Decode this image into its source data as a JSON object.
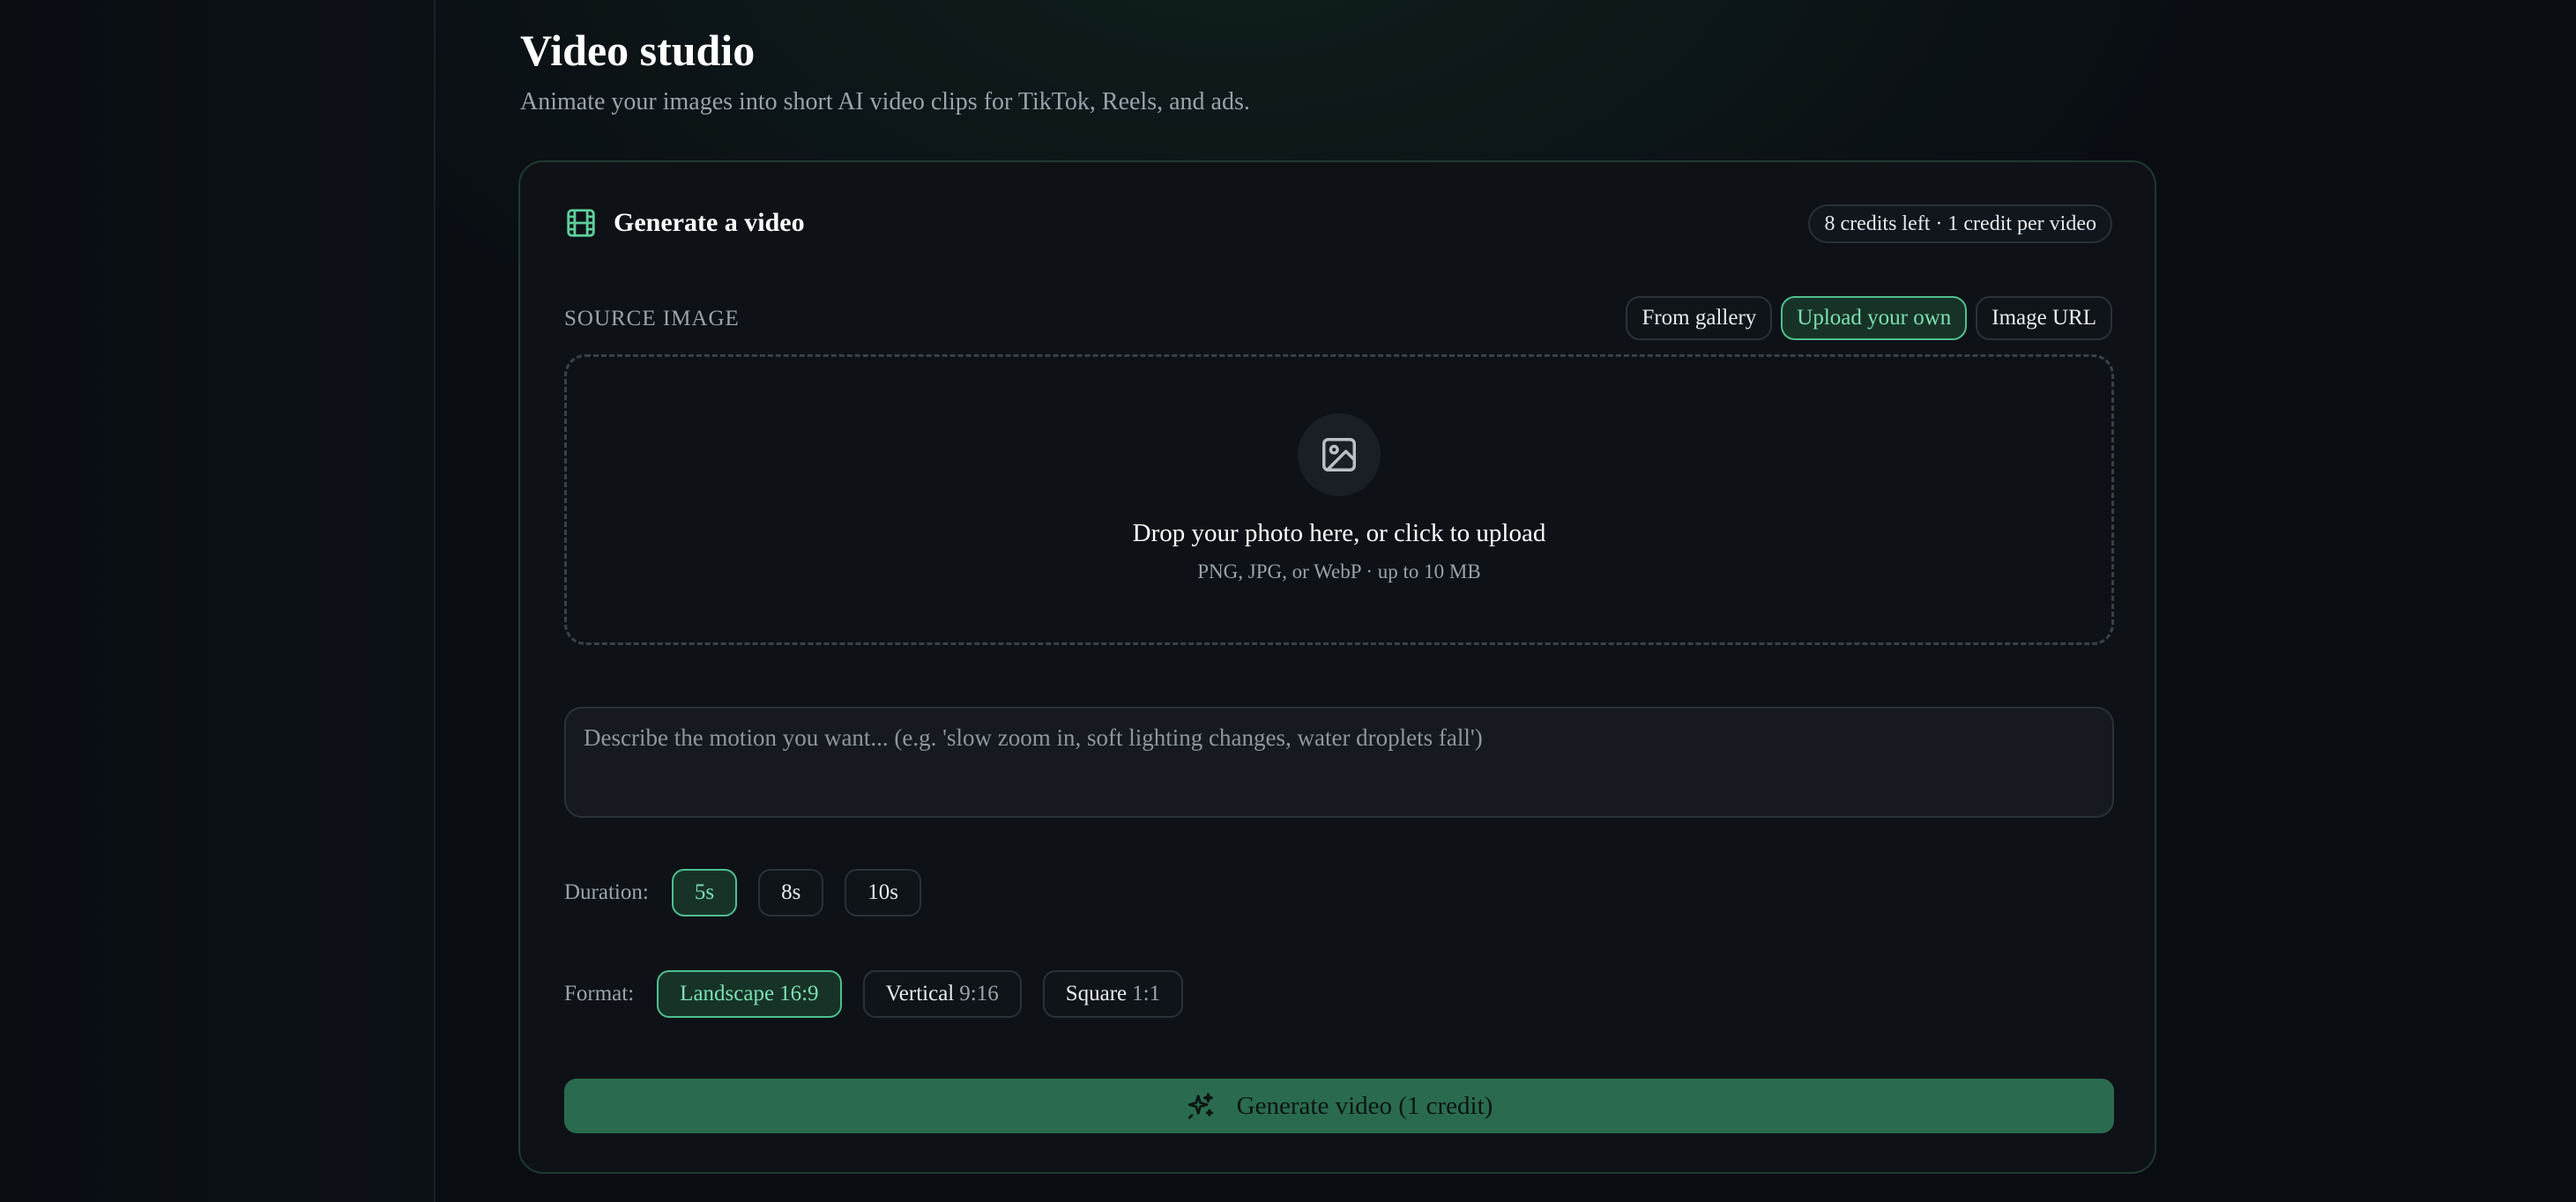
{
  "header": {
    "title": "Video studio",
    "subtitle": "Animate your images into short AI video clips for TikTok, Reels, and ads."
  },
  "card": {
    "title": "Generate a video",
    "title_icon": "film-icon",
    "credits": "8 credits left · 1 credit per video"
  },
  "source": {
    "label": "SOURCE IMAGE",
    "tabs": [
      {
        "label": "From gallery",
        "active": false
      },
      {
        "label": "Upload your own",
        "active": true
      },
      {
        "label": "Image URL",
        "active": false
      }
    ]
  },
  "dropzone": {
    "icon": "image-icon",
    "title": "Drop your photo here, or click to upload",
    "subtitle": "PNG, JPG, or WebP · up to 10 MB"
  },
  "motion": {
    "placeholder": "Describe the motion you want... (e.g. 'slow zoom in, soft lighting changes, water droplets fall')",
    "value": ""
  },
  "duration": {
    "label": "Duration:",
    "options": [
      {
        "label": "5s",
        "active": true
      },
      {
        "label": "8s",
        "active": false
      },
      {
        "label": "10s",
        "active": false
      }
    ]
  },
  "format": {
    "label": "Format:",
    "options": [
      {
        "name": "Landscape",
        "ratio": "16:9",
        "active": true
      },
      {
        "name": "Vertical",
        "ratio": "9:16",
        "active": false
      },
      {
        "name": "Square",
        "ratio": "1:1",
        "active": false
      }
    ]
  },
  "generate": {
    "label": "Generate video (1 credit)",
    "icon": "sparkle-icon"
  },
  "colors": {
    "accent": "#4fbf8f",
    "accent_text": "#7ee0b2",
    "button": "#2a6b4f",
    "background": "#0a0e13",
    "card": "#0e1217"
  }
}
